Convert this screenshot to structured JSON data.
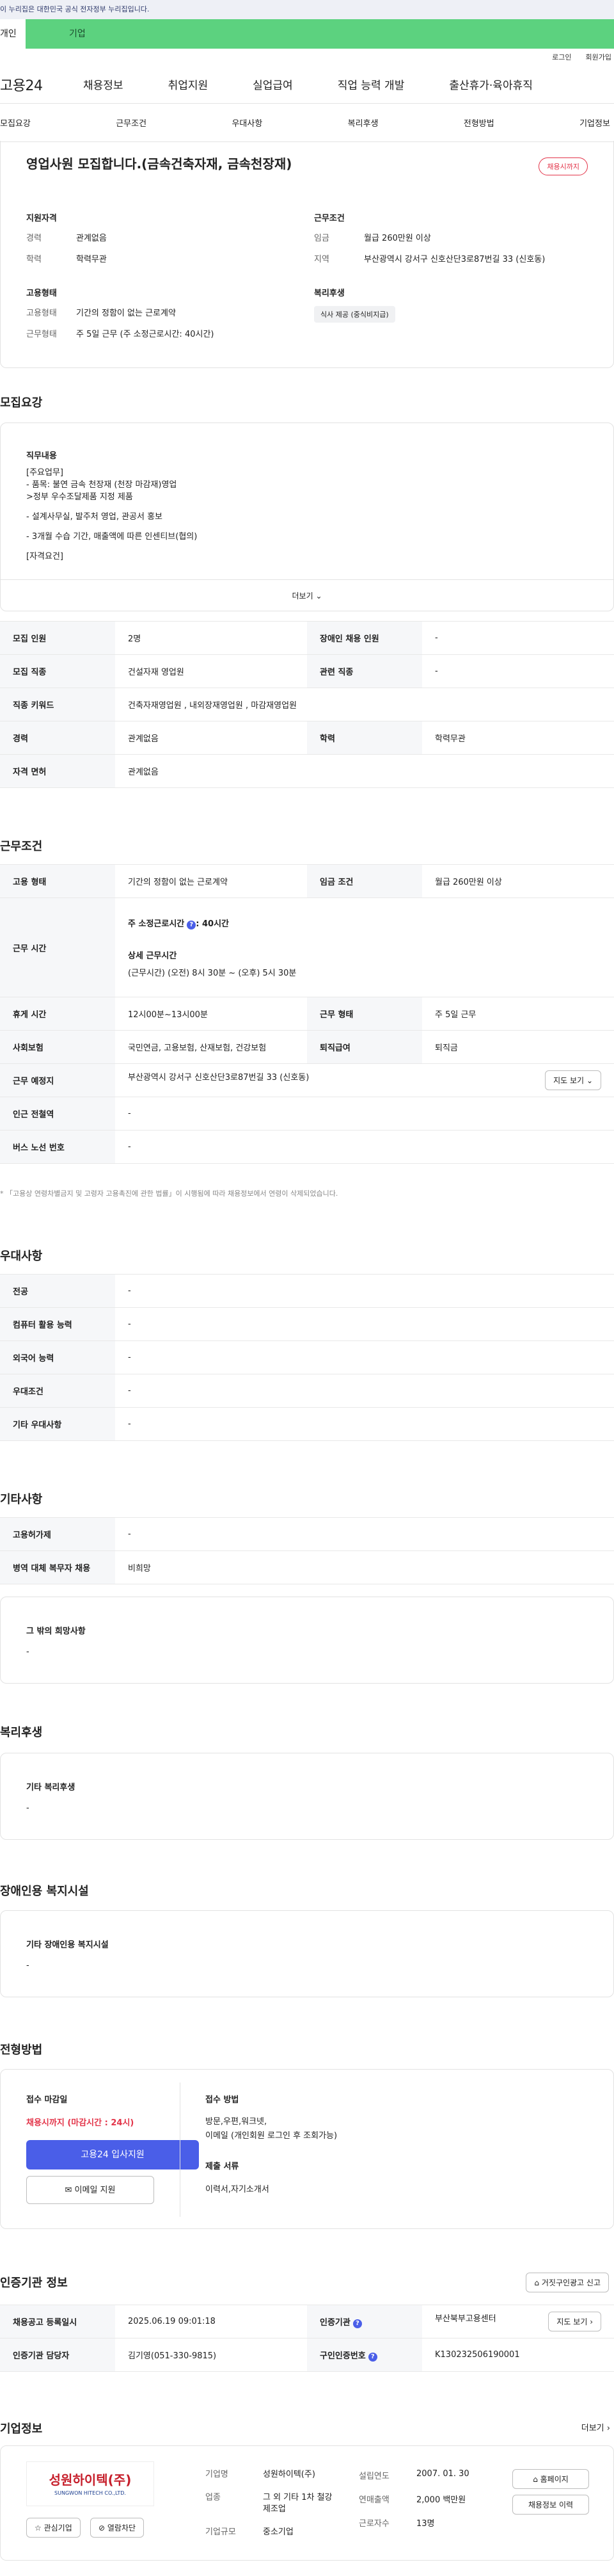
{
  "banner": "이 누리집은 대한민국 공식 전자정부 누리집입니다.",
  "tabs": {
    "personal": "개인",
    "company": "기업"
  },
  "utility": {
    "login": "로그인",
    "signup": "회원가입"
  },
  "gnb": {
    "logo": "고용24",
    "items": [
      "채용정보",
      "취업지원",
      "실업급여",
      "직업 능력 개발",
      "출산휴가·육아휴직"
    ]
  },
  "subnav": [
    "모집요강",
    "근무조건",
    "우대사항",
    "복리후생",
    "전형방법",
    "기업정보"
  ],
  "summary": {
    "title": "영업사원 모집합니다.(금속건축자재, 금속천장재)",
    "badge": "채용시까지",
    "qual_label": "지원자격",
    "career_k": "경력",
    "career_v": "관계없음",
    "edu_k": "학력",
    "edu_v": "학력무관",
    "cond_label": "근무조건",
    "wage_k": "임금",
    "wage_v": "월급 260만원 이상",
    "region_k": "지역",
    "region_v": "부산광역시 강서구 신호산단3로87번길 33 (신호동)",
    "emp_label": "고용형태",
    "emptype_k": "고용형태",
    "emptype_v": "기간의 정함이 없는 근로계약",
    "worktype_k": "근무형태",
    "worktype_v": "주 5일 근무 (주 소정근로시간: 40시간)",
    "welfare_label": "복리후생",
    "welfare_chip": "식사 제공 (중식비지급)"
  },
  "recruit": {
    "title": "모집요강",
    "duty_label": "직무내용",
    "duty_lines": [
      "[주요업무]",
      "- 품목: 불연 금속 천장재 (천장 마감재)영업",
      ">정부 우수조달제품 지정 제품",
      "- 설계사무실, 발주처 영업, 관공서 홍보",
      "- 3개월 수습 기간, 매출액에 따른 인센티브(협의)",
      "[자격요건]"
    ],
    "more": "더보기",
    "rows": [
      [
        "모집 인원",
        "2명",
        "장애인 채용 인원",
        "-"
      ],
      [
        "모집 직종",
        "건설자재 영업원",
        "관련 직종",
        "-"
      ],
      [
        "직종 키워드",
        "건축자재영업원 , 내외장재영업원 , 마감재영업원",
        "",
        ""
      ],
      [
        "경력",
        "관계없음",
        "학력",
        "학력무관"
      ],
      [
        "자격 면허",
        "관계없음",
        "",
        ""
      ]
    ]
  },
  "work": {
    "title": "근무조건",
    "emptype_k": "고용 형태",
    "emptype_v": "기간의 정함이 없는 근로계약",
    "wage_k": "임금 조건",
    "wage_v": "월급 260만원 이상",
    "hours_k": "근무 시간",
    "hours_week": "주 소정근로시간",
    "hours_week_v": ": 40시간",
    "hours_detail_label": "상세 근무시간",
    "hours_detail": "(근무시간) (오전) 8시 30분 ~ (오후) 5시 30분",
    "break_k": "휴게 시간",
    "break_v": "12시00분~13시00분",
    "form_k": "근무 형태",
    "form_v": "주 5일 근무",
    "insurance_k": "사회보험",
    "insurance_v": "국민연금, 고용보험, 산재보험, 건강보험",
    "retire_k": "퇴직급여",
    "retire_v": "퇴직금",
    "place_k": "근무 예정지",
    "place_v": "부산광역시 강서구 신호산단3로87번길 33 (신호동)",
    "map_btn": "지도 보기",
    "subway_k": "인근 전철역",
    "subway_v": "-",
    "bus_k": "버스 노선 번호",
    "bus_v": "-",
    "note": "* 「고용상 연령차별금지 및 고령자 고용촉진에 관한 법률」이 시행됨에 따라 채용정보에서 연령이 삭제되었습니다."
  },
  "pref": {
    "title": "우대사항",
    "rows": [
      [
        "전공",
        "-"
      ],
      [
        "컴퓨터 활용 능력",
        "-"
      ],
      [
        "외국어 능력",
        "-"
      ],
      [
        "우대조건",
        "-"
      ],
      [
        "기타 우대사항",
        "-"
      ]
    ]
  },
  "etc": {
    "title": "기타사항",
    "rows": [
      [
        "고용허가제",
        "-"
      ],
      [
        "병역 대체 복무자 채용",
        "비희망"
      ]
    ],
    "hope_label": "그 밖의 희망사항",
    "hope_v": "-"
  },
  "welfare": {
    "title": "복리후생",
    "label": "기타 복리후생",
    "value": "-"
  },
  "disabled": {
    "title": "장애인용 복지시설",
    "label": "기타 장애인용 복지시설",
    "value": "-"
  },
  "selection": {
    "title": "전형방법",
    "deadline_label": "접수 마감일",
    "deadline_v": "채용시까지 (마감시간 : 24시)",
    "apply_btn": "고용24 입사지원",
    "email_btn": "이메일 지원",
    "method_label": "접수 방법",
    "method_v1": "방문,우편,워크넷,",
    "method_v2": "이메일 (개인회원 로그인 후 조회가능)",
    "docs_label": "제출 서류",
    "docs_v": "이력서,자기소개서"
  },
  "agency": {
    "title": "인증기관 정보",
    "report_btn": "거짓구인광고 신고",
    "reg_k": "채용공고 등록일시",
    "reg_v": "2025.06.19 09:01:18",
    "org_k": "인증기관",
    "org_v": "부산북부고용센터",
    "map_btn": "지도 보기",
    "mgr_k": "인증기관 담당자",
    "mgr_v": "김기영(051-330-9815)",
    "num_k": "구인인증번호",
    "num_v": "K130232506190001"
  },
  "company": {
    "title": "기업정보",
    "more": "더보기",
    "logo_text": "성원하이텍(주)",
    "logo_en": "SUNGWON HITECH CO.,LTD.",
    "fav_btn": "관심기업",
    "block_btn": "열람차단",
    "name_k": "기업명",
    "name_v": "성원하이텍(주)",
    "biz_k": "업종",
    "biz_v": "그 외 기타 1차 철강 제조업",
    "size_k": "기업규모",
    "size_v": "중소기업",
    "year_k": "설립연도",
    "year_v": "2007. 01. 30",
    "sales_k": "연매출액",
    "sales_v": "2,000 백만원",
    "emp_k": "근로자수",
    "emp_v": "13명",
    "home_btn": "홈페이지",
    "jobs_btn": "채용정보 이력"
  },
  "colors": {
    "accent_green": "#5cd27f",
    "accent_blue": "#4a5ee8",
    "accent_red": "#e3354a"
  }
}
